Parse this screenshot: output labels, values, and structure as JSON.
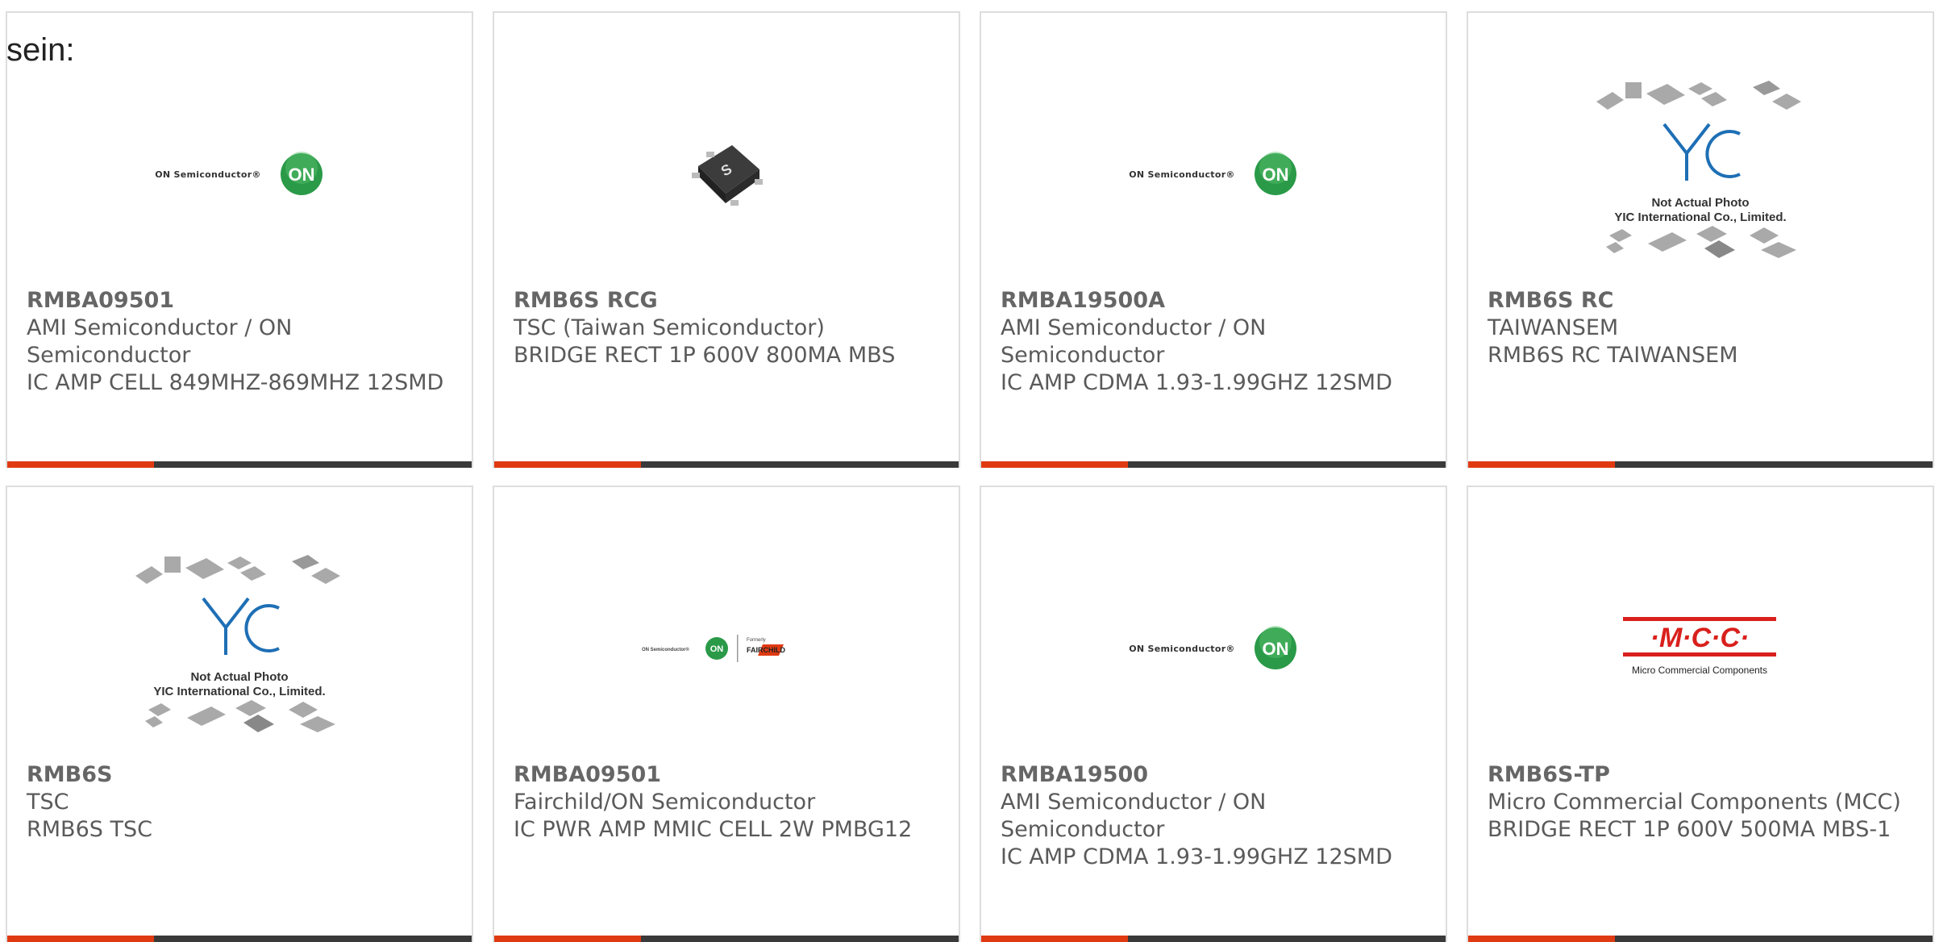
{
  "intro_text": "sein:",
  "products": [
    {
      "part": "RMBA09501",
      "manufacturer": "AMI Semiconductor / ON Semiconductor",
      "description": "IC AMP CELL 849MHZ-869MHZ 12SMD",
      "logo": "on-semiconductor-logo"
    },
    {
      "part": "RMB6S RCG",
      "manufacturer": "TSC (Taiwan Semiconductor)",
      "description": "BRIDGE RECT 1P 600V 800MA MBS",
      "logo": "mbs-package-photo"
    },
    {
      "part": "RMBA19500A",
      "manufacturer": "AMI Semiconductor / ON Semiconductor",
      "description": "IC AMP CDMA 1.93-1.99GHZ 12SMD",
      "logo": "on-semiconductor-logo"
    },
    {
      "part": "RMB6S RC",
      "manufacturer": "TAIWANSEM",
      "description": "RMB6S RC TAIWANSEM",
      "logo": "yic-not-actual-photo"
    },
    {
      "part": "RMB6S",
      "manufacturer": "TSC",
      "description": "RMB6S TSC",
      "logo": "yic-not-actual-photo"
    },
    {
      "part": "RMBA09501",
      "manufacturer": "Fairchild/ON Semiconductor",
      "description": "IC PWR AMP MMIC CELL 2W PMBG12",
      "logo": "on-fairchild-logo"
    },
    {
      "part": "RMBA19500",
      "manufacturer": "AMI Semiconductor / ON Semiconductor",
      "description": "IC AMP CDMA 1.93-1.99GHZ 12SMD",
      "logo": "on-semiconductor-logo"
    },
    {
      "part": "RMB6S-TP",
      "manufacturer": "Micro Commercial Components (MCC)",
      "description": "BRIDGE RECT 1P 600V 500MA MBS-1",
      "logo": "mcc-logo"
    }
  ],
  "logo_text": {
    "on_company": "ON Semiconductor®",
    "on_mark": "ON",
    "formerly": "Formerly",
    "fairchild": "FAIRCHILD",
    "yic_line1": "Not Actual Photo",
    "yic_line2": "YIC International Co., Limited.",
    "mcc_mark": "·M·C·C·",
    "mcc_sub": "Micro Commercial Components",
    "package_mark": "S"
  },
  "colors": {
    "accent": "#e03a12",
    "bar": "#3a3a3a",
    "on_green": "#2a9a48",
    "yic_blue": "#1e6fb5",
    "mcc_red": "#d9201c"
  }
}
